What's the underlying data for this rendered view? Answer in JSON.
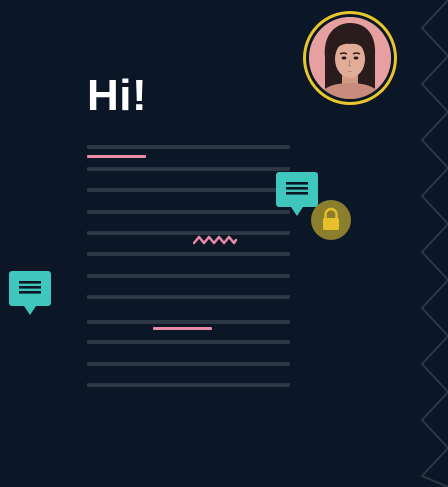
{
  "greeting": "Hi!",
  "colors": {
    "background": "#0b1626",
    "line": "#2c3744",
    "highlight": "#e88aa8",
    "comment": "#3fc7bd",
    "avatar_ring": "#e9c62c",
    "lock": "#8b7f2e",
    "lock_icon": "#e6c02a"
  },
  "icons": {
    "comment": "comment-icon",
    "lock": "lock-icon",
    "avatar": "avatar-photo"
  }
}
